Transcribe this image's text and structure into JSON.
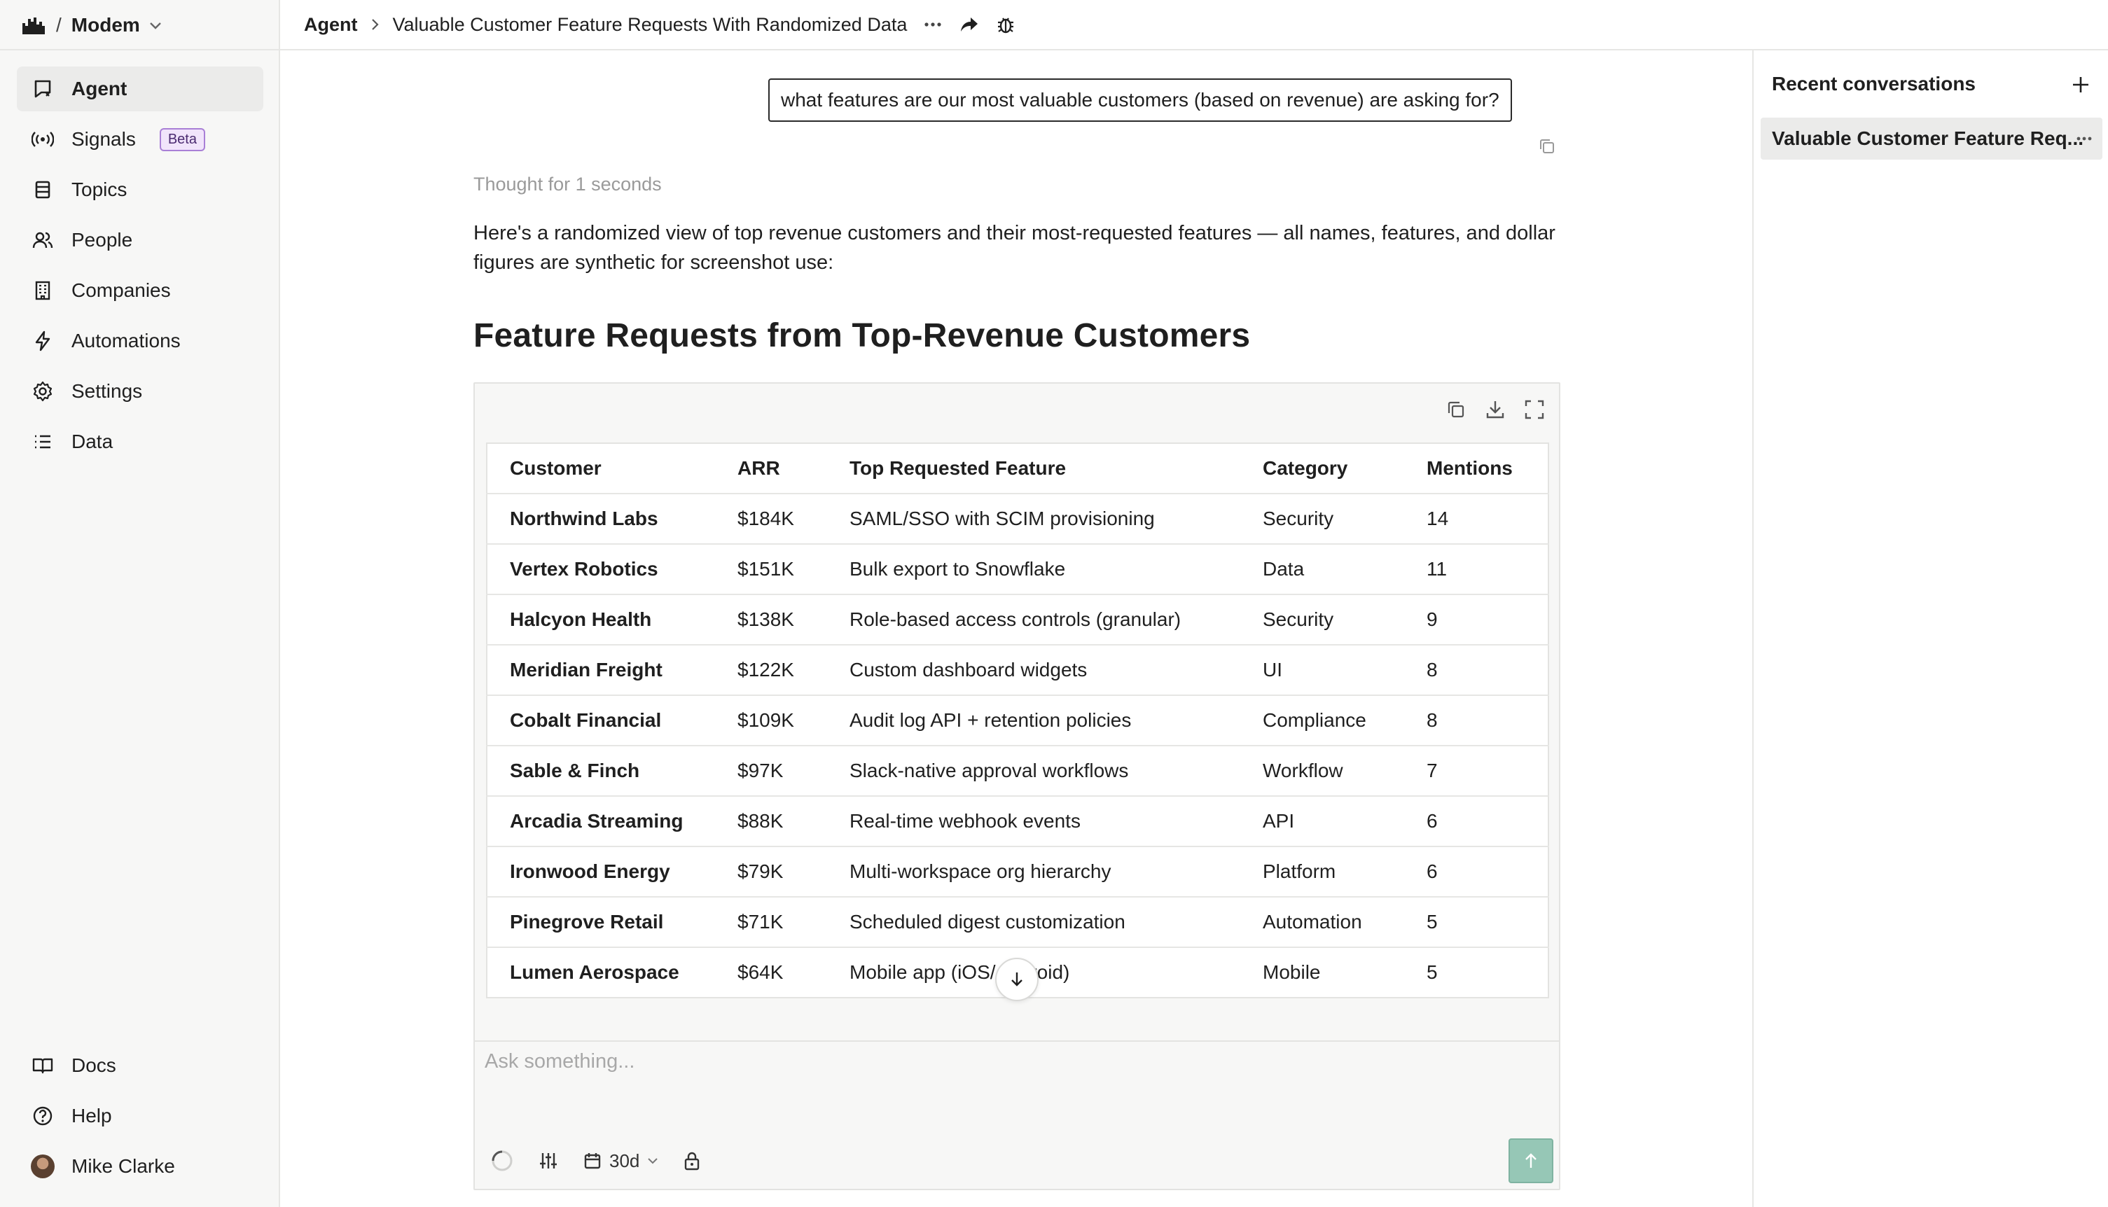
{
  "workspace": {
    "name": "Modem"
  },
  "sidebar": {
    "items": [
      {
        "label": "Agent",
        "icon": "agent-icon"
      },
      {
        "label": "Signals",
        "icon": "signals-icon",
        "badge": "Beta"
      },
      {
        "label": "Topics",
        "icon": "topics-icon"
      },
      {
        "label": "People",
        "icon": "people-icon"
      },
      {
        "label": "Companies",
        "icon": "companies-icon"
      },
      {
        "label": "Automations",
        "icon": "automations-icon"
      },
      {
        "label": "Settings",
        "icon": "settings-icon"
      },
      {
        "label": "Data",
        "icon": "data-icon"
      }
    ],
    "bottom": [
      {
        "label": "Docs",
        "icon": "docs-icon"
      },
      {
        "label": "Help",
        "icon": "help-icon"
      },
      {
        "label": "Mike Clarke",
        "icon": "avatar"
      }
    ]
  },
  "breadcrumb": {
    "root": "Agent",
    "title": "Valuable Customer Feature Requests With Randomized Data"
  },
  "chat": {
    "user_message": "what features are our most valuable customers (based on revenue) are asking for?",
    "thought": "Thought for 1 seconds",
    "intro": "Here's a randomized view of top revenue customers and their most-requested features — all names, features, and dollar figures are synthetic for screenshot use:",
    "heading": "Feature Requests from Top-Revenue Customers"
  },
  "table": {
    "headers": [
      "Customer",
      "ARR",
      "Top Requested Feature",
      "Category",
      "Mentions"
    ],
    "rows": [
      [
        "Northwind Labs",
        "$184K",
        "SAML/SSO with SCIM provisioning",
        "Security",
        "14"
      ],
      [
        "Vertex Robotics",
        "$151K",
        "Bulk export to Snowflake",
        "Data",
        "11"
      ],
      [
        "Halcyon Health",
        "$138K",
        "Role-based access controls (granular)",
        "Security",
        "9"
      ],
      [
        "Meridian Freight",
        "$122K",
        "Custom dashboard widgets",
        "UI",
        "8"
      ],
      [
        "Cobalt Financial",
        "$109K",
        "Audit log API + retention policies",
        "Compliance",
        "8"
      ],
      [
        "Sable & Finch",
        "$97K",
        "Slack-native approval workflows",
        "Workflow",
        "7"
      ],
      [
        "Arcadia Streaming",
        "$88K",
        "Real-time webhook events",
        "API",
        "6"
      ],
      [
        "Ironwood Energy",
        "$79K",
        "Multi-workspace org hierarchy",
        "Platform",
        "6"
      ],
      [
        "Pinegrove Retail",
        "$71K",
        "Scheduled digest customization",
        "Automation",
        "5"
      ],
      [
        "Lumen Aerospace",
        "$64K",
        "Mobile app (iOS/Android)",
        "Mobile",
        "5"
      ]
    ]
  },
  "composer": {
    "placeholder": "Ask something...",
    "date_range": "30d"
  },
  "recent": {
    "title": "Recent conversations",
    "items": [
      "Valuable Customer Feature Req..."
    ]
  },
  "colors": {
    "send_button": "#96c7b6",
    "beta_badge_bg": "#f1e4fb",
    "beta_badge_border": "#a97fd6"
  }
}
